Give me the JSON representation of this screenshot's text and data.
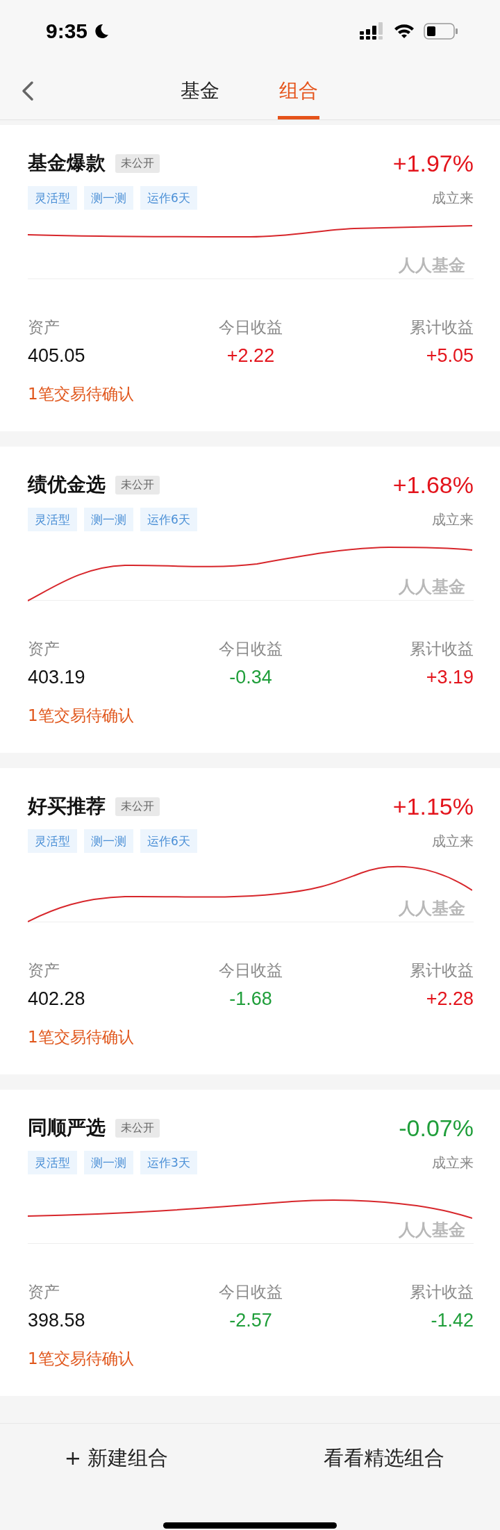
{
  "status_bar": {
    "time": "9:35"
  },
  "nav": {
    "tabs": [
      {
        "label": "基金",
        "selected": false
      },
      {
        "label": "组合",
        "selected": true
      }
    ]
  },
  "portfolios": [
    {
      "name": "基金爆款",
      "badge": "未公开",
      "return": {
        "text": "+1.97%",
        "color": "#e3141c"
      },
      "tags": [
        "灵活型",
        "测一测",
        "运作6天"
      ],
      "return_caption": "成立来",
      "chart_watermark": "人人基金",
      "stats": [
        {
          "label": "资产",
          "value": {
            "text": "405.05",
            "color": "#111111"
          }
        },
        {
          "label": "今日收益",
          "value": {
            "text": "+2.22",
            "color": "#e3141c"
          }
        },
        {
          "label": "累计收益",
          "value": {
            "text": "+5.05",
            "color": "#e3141c"
          }
        }
      ],
      "pending": "1笔交易待确认"
    },
    {
      "name": "绩优金选",
      "badge": "未公开",
      "return": {
        "text": "+1.68%",
        "color": "#e3141c"
      },
      "tags": [
        "灵活型",
        "测一测",
        "运作6天"
      ],
      "return_caption": "成立来",
      "chart_watermark": "人人基金",
      "stats": [
        {
          "label": "资产",
          "value": {
            "text": "403.19",
            "color": "#111111"
          }
        },
        {
          "label": "今日收益",
          "value": {
            "text": "-0.34",
            "color": "#1f9e3a"
          }
        },
        {
          "label": "累计收益",
          "value": {
            "text": "+3.19",
            "color": "#e3141c"
          }
        }
      ],
      "pending": "1笔交易待确认"
    },
    {
      "name": "好买推荐",
      "badge": "未公开",
      "return": {
        "text": "+1.15%",
        "color": "#e3141c"
      },
      "tags": [
        "灵活型",
        "测一测",
        "运作6天"
      ],
      "return_caption": "成立来",
      "chart_watermark": "人人基金",
      "stats": [
        {
          "label": "资产",
          "value": {
            "text": "402.28",
            "color": "#111111"
          }
        },
        {
          "label": "今日收益",
          "value": {
            "text": "-1.68",
            "color": "#1f9e3a"
          }
        },
        {
          "label": "累计收益",
          "value": {
            "text": "+2.28",
            "color": "#e3141c"
          }
        }
      ],
      "pending": "1笔交易待确认"
    },
    {
      "name": "同顺严选",
      "badge": "未公开",
      "return": {
        "text": "-0.07%",
        "color": "#1f9e3a"
      },
      "tags": [
        "灵活型",
        "测一测",
        "运作3天"
      ],
      "return_caption": "成立来",
      "chart_watermark": "人人基金",
      "stats": [
        {
          "label": "资产",
          "value": {
            "text": "398.58",
            "color": "#111111"
          }
        },
        {
          "label": "今日收益",
          "value": {
            "text": "-2.57",
            "color": "#1f9e3a"
          }
        },
        {
          "label": "累计收益",
          "value": {
            "text": "-1.42",
            "color": "#1f9e3a"
          }
        }
      ],
      "pending": "1笔交易待确认"
    }
  ],
  "actions": [
    "+ 新建组合",
    "看看精选组合"
  ]
}
